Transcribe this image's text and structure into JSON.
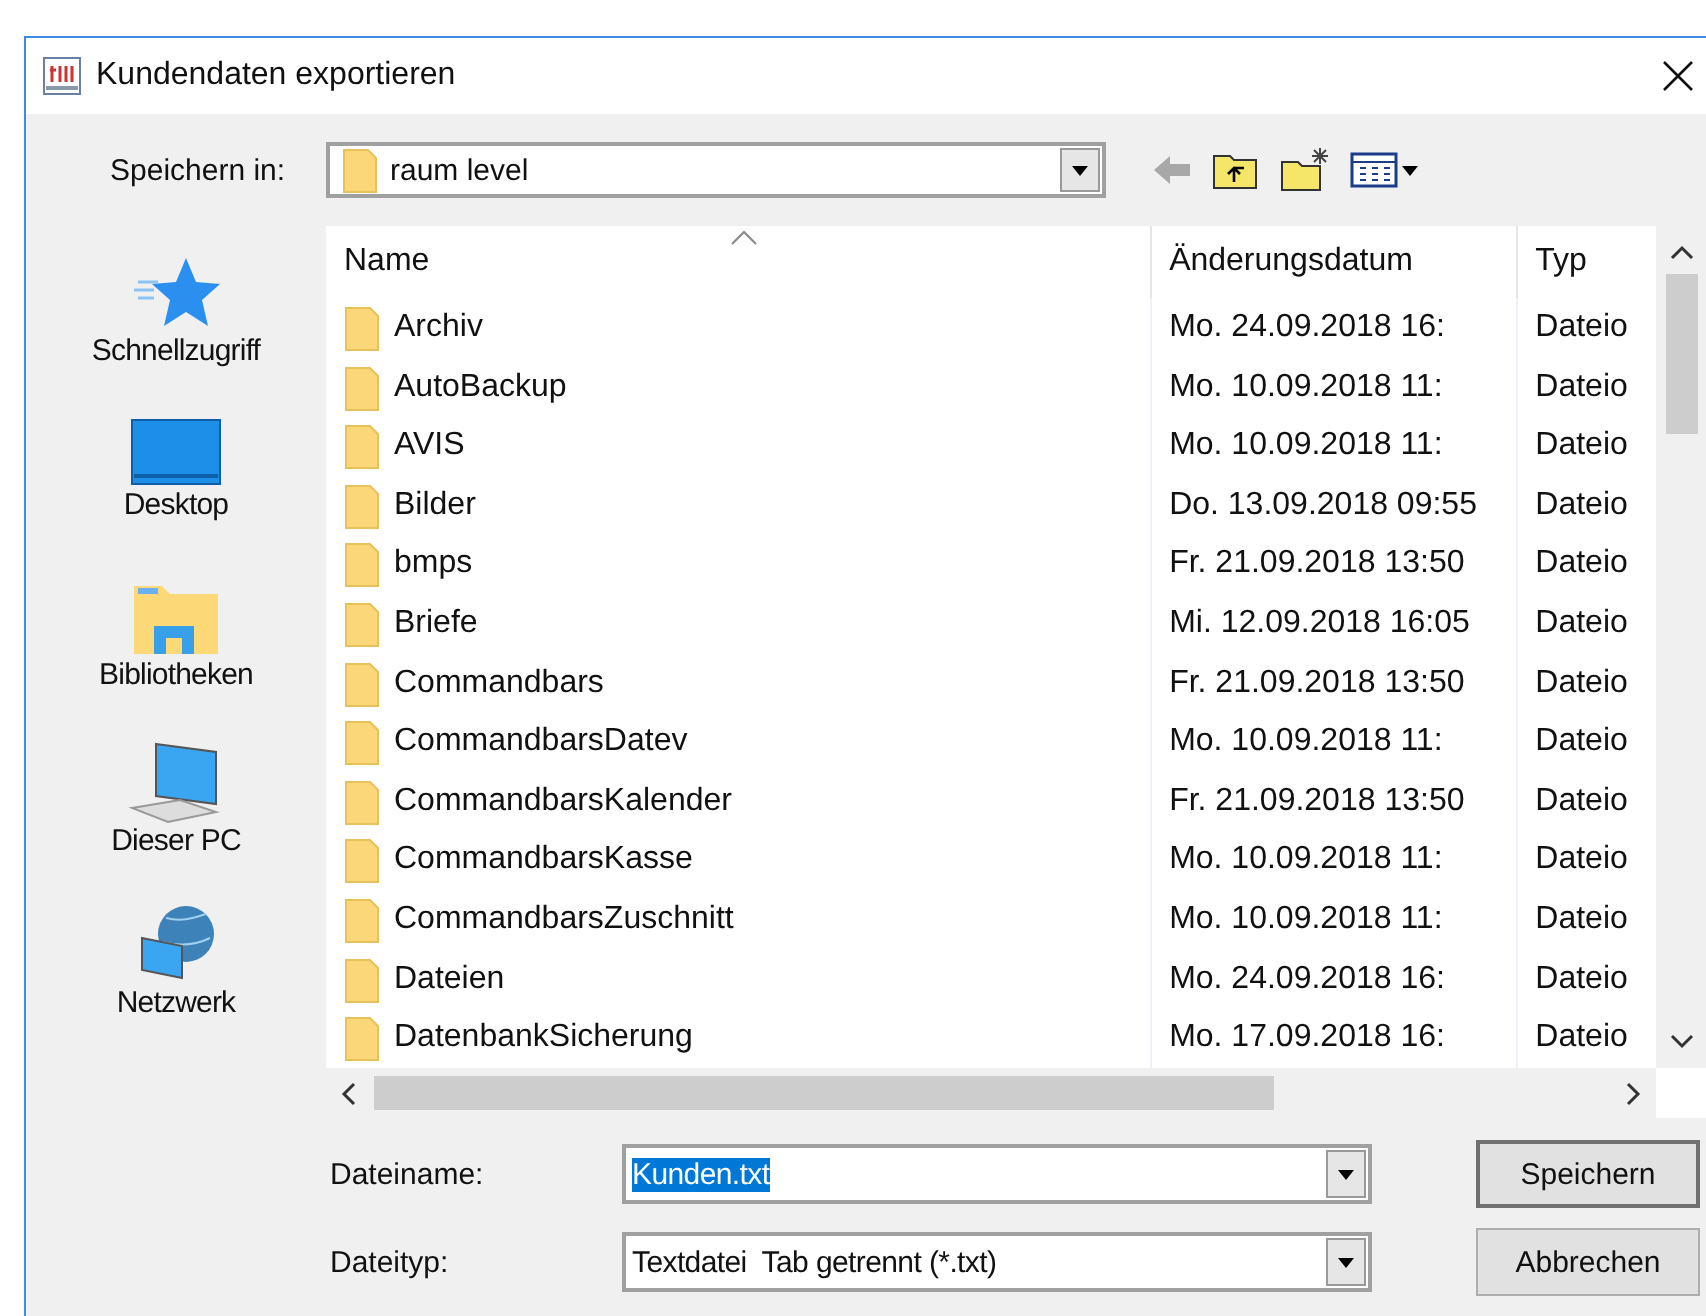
{
  "window": {
    "title": "Kundendaten exportieren"
  },
  "save_in": {
    "label": "Speichern in:",
    "value": "raum level"
  },
  "toolbar": [
    {
      "kind": "back",
      "disabled": true
    },
    {
      "kind": "up"
    },
    {
      "kind": "newfolder"
    },
    {
      "kind": "view"
    }
  ],
  "sidebar": {
    "items": [
      {
        "label": "Schnellzugriff",
        "kind": "star"
      },
      {
        "label": "Desktop",
        "kind": "desktop"
      },
      {
        "label": "Bibliotheken",
        "kind": "library"
      },
      {
        "label": "Dieser PC",
        "kind": "pc"
      },
      {
        "label": "Netzwerk",
        "kind": "network"
      }
    ]
  },
  "table": {
    "columns": [
      "Name",
      "Änderungsdatum",
      "Typ"
    ],
    "rows": [
      {
        "name": "Archiv",
        "date": "Mo. 24.09.2018 16:",
        "type": "Dateio"
      },
      {
        "name": "AutoBackup",
        "date": "Mo. 10.09.2018 11:",
        "type": "Dateio"
      },
      {
        "name": "AVIS",
        "date": "Mo. 10.09.2018 11:",
        "type": "Dateio"
      },
      {
        "name": "Bilder",
        "date": "Do. 13.09.2018 09:55",
        "type": "Dateio"
      },
      {
        "name": "bmps",
        "date": "Fr. 21.09.2018 13:50",
        "type": "Dateio"
      },
      {
        "name": "Briefe",
        "date": "Mi. 12.09.2018 16:05",
        "type": "Dateio"
      },
      {
        "name": "Commandbars",
        "date": "Fr. 21.09.2018 13:50",
        "type": "Dateio"
      },
      {
        "name": "CommandbarsDatev",
        "date": "Mo. 10.09.2018 11:",
        "type": "Dateio"
      },
      {
        "name": "CommandbarsKalender",
        "date": "Fr. 21.09.2018 13:50",
        "type": "Dateio"
      },
      {
        "name": "CommandbarsKasse",
        "date": "Mo. 10.09.2018 11:",
        "type": "Dateio"
      },
      {
        "name": "CommandbarsZuschnitt",
        "date": "Mo. 10.09.2018 11:",
        "type": "Dateio"
      },
      {
        "name": "Dateien",
        "date": "Mo. 24.09.2018 16:",
        "type": "Dateio"
      },
      {
        "name": "DatenbankSicherung",
        "date": "Mo. 17.09.2018 16:",
        "type": "Dateio"
      }
    ]
  },
  "filename": {
    "label": "Dateiname:",
    "value": "Kunden.txt",
    "text_selected": true
  },
  "filetype": {
    "label": "Dateityp:",
    "value": "Textdatei  Tab getrennt (*.txt)"
  },
  "buttons": [
    {
      "label": "Speichern",
      "default": true
    },
    {
      "label": "Abbrechen",
      "default": false
    }
  ]
}
